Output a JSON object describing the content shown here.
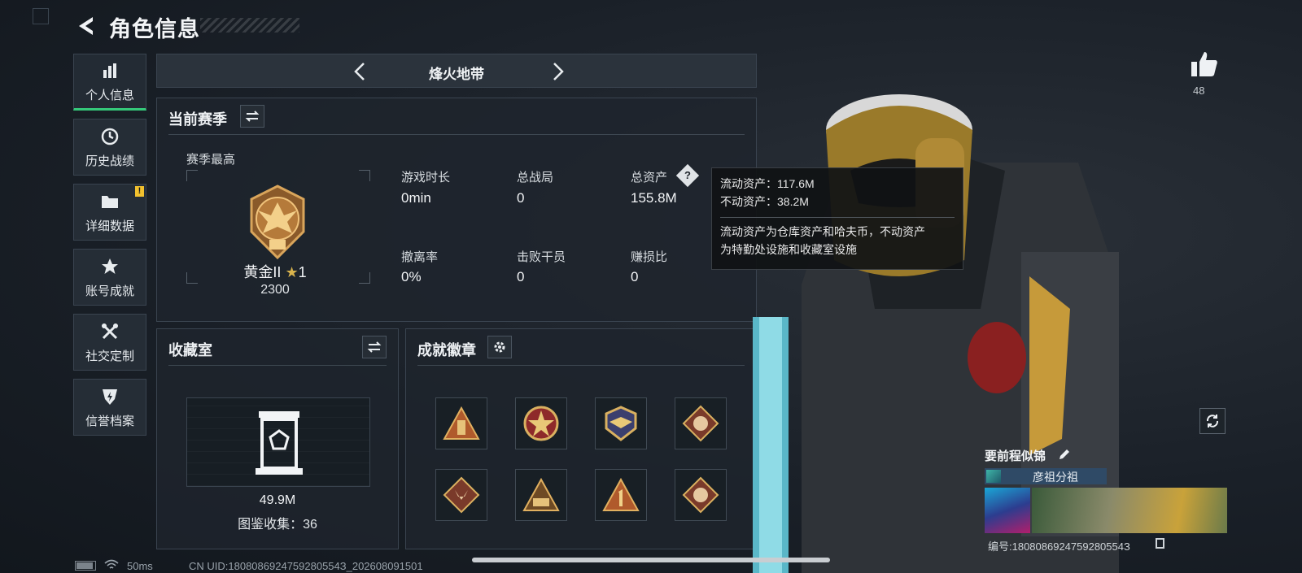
{
  "header": {
    "title": "角色信息"
  },
  "sidebar": {
    "items": [
      {
        "label": "个人信息",
        "icon": "bar-chart-icon",
        "active": true
      },
      {
        "label": "历史战绩",
        "icon": "history-clock-icon"
      },
      {
        "label": "详细数据",
        "icon": "folder-icon",
        "badge": "!"
      },
      {
        "label": "账号成就",
        "icon": "achievement-star-icon"
      },
      {
        "label": "社交定制",
        "icon": "tools-icon"
      },
      {
        "label": "信誉档案",
        "icon": "shield-lightning-icon"
      }
    ]
  },
  "season_nav": {
    "title": "烽火地带"
  },
  "current_season": {
    "title": "当前赛季",
    "peak_label": "赛季最高",
    "rank_name": "黄金II",
    "rank_stars": "1",
    "rank_score": "2300",
    "stats": [
      {
        "label": "游戏时长",
        "value": "0min"
      },
      {
        "label": "总战局",
        "value": "0"
      },
      {
        "label": "总资产",
        "value": "155.8M"
      },
      {
        "label": "撤离率",
        "value": "0%"
      },
      {
        "label": "击败干员",
        "value": "0"
      },
      {
        "label": "赚损比",
        "value": "0"
      }
    ]
  },
  "tooltip": {
    "liquid": "流动资产：117.6M",
    "fixed": "不动资产：38.2M",
    "desc_line1": "流动资产为仓库资产和哈夫币，不动资产",
    "desc_line2": "为特勤处设施和收藏室设施"
  },
  "collection": {
    "title": "收藏室",
    "value": "49.9M",
    "catalog": "图鉴收集：36"
  },
  "achievements": {
    "title": "成就徽章",
    "badges": [
      "triangle-tower-badge",
      "shield-star-badge",
      "winged-emblem-badge",
      "dragon-diamond-badge",
      "wolf-diamond-badge",
      "triangle-squad-badge",
      "triangle-one-badge",
      "dragon-diamond-badge-2"
    ]
  },
  "profile": {
    "likes": "48",
    "player_name": "要前程似锦",
    "clan": "彦祖分祖",
    "uid_line": "编号:1808086924759280554З"
  },
  "footer": {
    "ping": "50ms",
    "uid": "CN UID:1808086924759280554З_202608091501"
  },
  "colors": {
    "accent_green": "#35c97a",
    "warn_yellow": "#f2c12e",
    "clan_blue": "#2f4a66"
  }
}
